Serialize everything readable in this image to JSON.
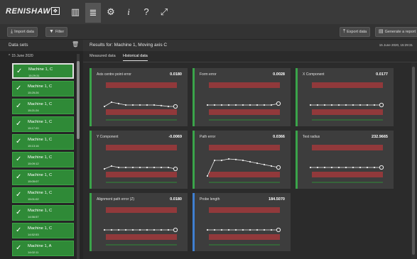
{
  "app": {
    "logo_text": "RENISHAW",
    "logo_mark": "❖"
  },
  "nav": {
    "icons": [
      {
        "name": "layout-icon",
        "glyph": "▥"
      },
      {
        "name": "clipboard-icon",
        "glyph": "≣"
      },
      {
        "name": "gear-icon",
        "glyph": "⚙"
      },
      {
        "name": "info-icon",
        "glyph": "i"
      },
      {
        "name": "help-icon",
        "glyph": "?"
      },
      {
        "name": "fullscreen-icon",
        "glyph": "⤢"
      }
    ]
  },
  "toolbar": {
    "import_label": "Import data",
    "filter_label": "Filter",
    "export_label": "Export data",
    "report_label": "Generate a report"
  },
  "sidebar": {
    "title": "Data sets",
    "group_label": "15 June 2020",
    "items": [
      {
        "name": "Machine 1, C",
        "time": "15:29:31"
      },
      {
        "name": "Machine 1, C",
        "time": "15:25:26"
      },
      {
        "name": "Machine 1, C",
        "time": "15:21:24"
      },
      {
        "name": "Machine 1, C",
        "time": "15:17:20"
      },
      {
        "name": "Machine 1, C",
        "time": "15:13:16"
      },
      {
        "name": "Machine 1, C",
        "time": "15:09:12"
      },
      {
        "name": "Machine 1, C",
        "time": "15:05:07"
      },
      {
        "name": "Machine 1, C",
        "time": "15:01:02"
      },
      {
        "name": "Machine 1, C",
        "time": "14:56:57"
      },
      {
        "name": "Machine 1, C",
        "time": "14:52:53"
      },
      {
        "name": "Machine 1, A",
        "time": "14:02:11"
      }
    ]
  },
  "main": {
    "title": "Results for: Machine 1, Moving axis C",
    "date": "15 June 2020, 15:29:31",
    "tabs": [
      "Measured data",
      "Historical data"
    ]
  },
  "cards": [
    {
      "title": "Axis centre point error",
      "value": "0.0180",
      "color": "green",
      "series": [
        0.45,
        0.6,
        0.55,
        0.5,
        0.5,
        0.5,
        0.5,
        0.5,
        0.48,
        0.45,
        0.45
      ]
    },
    {
      "title": "Form error",
      "value": "0.0028",
      "color": "green",
      "series": [
        0.5,
        0.5,
        0.5,
        0.5,
        0.5,
        0.5,
        0.5,
        0.5,
        0.5,
        0.5,
        0.55
      ]
    },
    {
      "title": "X Component",
      "value": "0.0177",
      "color": "green",
      "series": [
        0.5,
        0.5,
        0.5,
        0.5,
        0.5,
        0.5,
        0.5,
        0.5,
        0.5,
        0.5,
        0.5
      ]
    },
    {
      "title": "Y Component",
      "value": "-0.0069",
      "color": "green",
      "series": [
        0.45,
        0.55,
        0.5,
        0.5,
        0.5,
        0.5,
        0.5,
        0.5,
        0.5,
        0.5,
        0.45
      ]
    },
    {
      "title": "Path error",
      "value": "0.0366",
      "color": "green",
      "series": [
        0.2,
        0.75,
        0.75,
        0.8,
        0.78,
        0.75,
        0.7,
        0.65,
        0.6,
        0.55,
        0.5
      ]
    },
    {
      "title": "Test radius",
      "value": "232.9665",
      "color": "green",
      "series": [
        0.5,
        0.5,
        0.5,
        0.5,
        0.5,
        0.5,
        0.5,
        0.5,
        0.5,
        0.5,
        0.5
      ]
    },
    {
      "title": "Alignment path error (Z)",
      "value": "0.0180",
      "color": "green",
      "series": [
        0.5,
        0.5,
        0.5,
        0.5,
        0.5,
        0.5,
        0.5,
        0.5,
        0.5,
        0.5,
        0.5
      ]
    },
    {
      "title": "Probe length",
      "value": "184.5070",
      "color": "blue",
      "series": [
        0.5,
        0.5,
        0.5,
        0.5,
        0.5,
        0.5,
        0.5,
        0.5,
        0.5,
        0.5,
        0.5
      ]
    }
  ],
  "colors": {
    "green": "#3aa44a",
    "blue": "#3f7fd0",
    "limit_band": "#a0383b",
    "nominal_line": "#2f8a37"
  }
}
